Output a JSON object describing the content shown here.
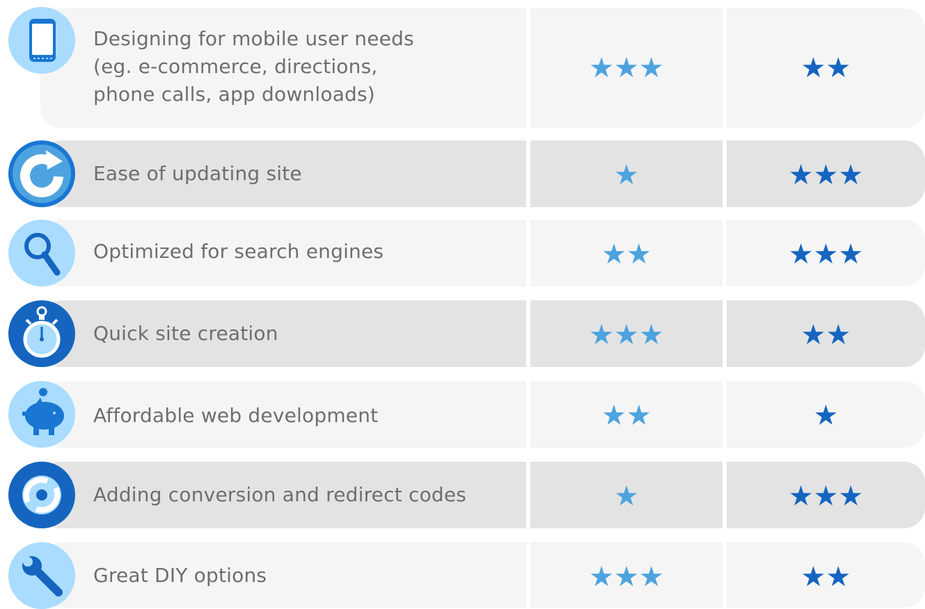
{
  "colors": {
    "row_light": "#f5f5f5",
    "row_dark": "#e3e3e3",
    "text": "#6e6e6e",
    "star_col1": "#4da3df",
    "star_col2": "#1565c0",
    "icon_light_bg": "#a9dcff",
    "icon_dark_bg": "#1976d2"
  },
  "rows": [
    {
      "label": "Designing for mobile user needs\n(eg. e-commerce, directions,\nphone calls, app downloads)",
      "icon": "mobile-phone-icon",
      "col1_rating": 3,
      "col2_rating": 2,
      "col1_stars": "★★★",
      "col2_stars": "★★"
    },
    {
      "label": "Ease of updating site",
      "icon": "refresh-arrow-icon",
      "col1_rating": 1,
      "col2_rating": 3,
      "col1_stars": "★",
      "col2_stars": "★★★"
    },
    {
      "label": "Optimized for search engines",
      "icon": "magnifier-icon",
      "col1_rating": 2,
      "col2_rating": 3,
      "col1_stars": "★★",
      "col2_stars": "★★★"
    },
    {
      "label": "Quick site creation",
      "icon": "stopwatch-icon",
      "col1_rating": 3,
      "col2_rating": 2,
      "col1_stars": "★★★",
      "col2_stars": "★★"
    },
    {
      "label": "Affordable web development",
      "icon": "piggy-bank-icon",
      "col1_rating": 2,
      "col2_rating": 1,
      "col1_stars": "★★",
      "col2_stars": "★"
    },
    {
      "label": "Adding conversion and redirect codes",
      "icon": "sync-arrows-icon",
      "col1_rating": 1,
      "col2_rating": 3,
      "col1_stars": "★",
      "col2_stars": "★★★"
    },
    {
      "label": "Great DIY options",
      "icon": "wrench-icon",
      "col1_rating": 3,
      "col2_rating": 2,
      "col1_stars": "★★★",
      "col2_stars": "★★"
    }
  ]
}
